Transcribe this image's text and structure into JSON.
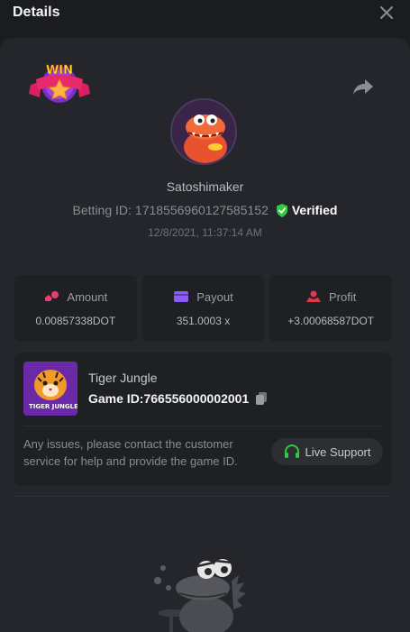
{
  "header": {
    "title": "Details",
    "close_icon": "close-icon"
  },
  "badge": {
    "text": "WIN"
  },
  "user": {
    "name": "Satoshimaker"
  },
  "bet": {
    "id_label": "Betting ID:",
    "id_value": "1718556960127585152",
    "verified_label": "Verified",
    "timestamp": "12/8/2021, 11:37:14 AM"
  },
  "stats": [
    {
      "label": "Amount",
      "value": "0.00857338DOT",
      "icon": "amount-icon",
      "color": "#e8406a"
    },
    {
      "label": "Payout",
      "value": "351.0003 x",
      "icon": "payout-icon",
      "color": "#8b5cf6"
    },
    {
      "label": "Profit",
      "value": "+3.00068587DOT",
      "icon": "profit-icon",
      "color": "#e0384f"
    }
  ],
  "game": {
    "name": "Tiger Jungle",
    "id_text": "Game ID:766556000002001",
    "thumb_title": "TIGER JUNGLE"
  },
  "support": {
    "text": "Any issues, please contact the customer service for help and provide the game ID.",
    "button_label": "Live Support"
  },
  "colors": {
    "accent_green": "#2ecc40",
    "panel": "#24262b",
    "card": "#1e2024"
  }
}
